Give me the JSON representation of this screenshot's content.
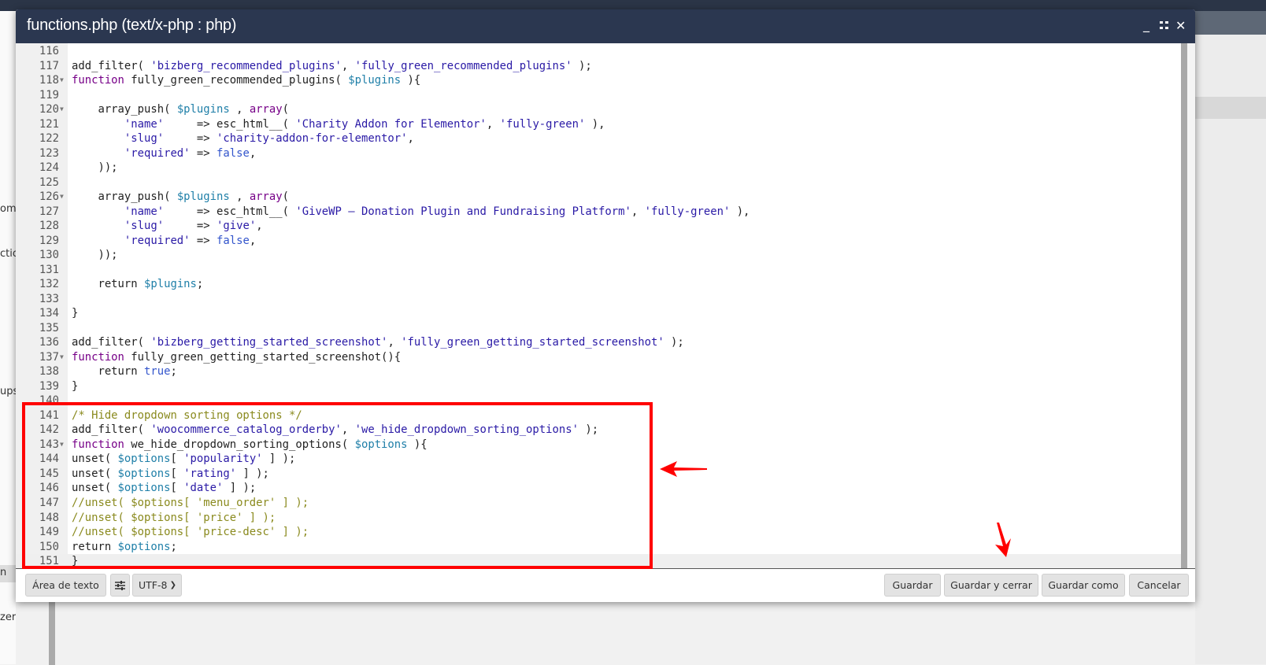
{
  "background_fragments": [
    "om",
    "ctio",
    "ups",
    "n",
    "zer"
  ],
  "dialog": {
    "title": "functions.php (text/x-php : php)",
    "controls": {
      "minimize": "_",
      "maximize": "⛶",
      "close": "✕"
    },
    "footer": {
      "textarea_button": "Área de texto",
      "settings_icon": "sliders-icon",
      "encoding": "UTF-8",
      "save": "Guardar",
      "save_close": "Guardar y cerrar",
      "save_as": "Guardar como",
      "cancel": "Cancelar"
    }
  },
  "annotation_color": "#ff0000",
  "code": [
    {
      "n": "116",
      "t": []
    },
    {
      "n": "117",
      "t": [
        [
          "",
          "add_filter( "
        ],
        [
          "s",
          "'bizberg_recommended_plugins'"
        ],
        [
          "",
          ", "
        ],
        [
          "s",
          "'fully_green_recommended_plugins'"
        ],
        [
          "",
          " );"
        ]
      ]
    },
    {
      "n": "118",
      "fold": true,
      "t": [
        [
          "k",
          "function"
        ],
        [
          "",
          " fully_green_recommended_plugins( "
        ],
        [
          "v",
          "$plugins"
        ],
        [
          "",
          " ){"
        ]
      ]
    },
    {
      "n": "119",
      "t": []
    },
    {
      "n": "120",
      "fold": true,
      "t": [
        [
          "",
          "    array_push( "
        ],
        [
          "v",
          "$plugins"
        ],
        [
          "",
          " , "
        ],
        [
          "k",
          "array"
        ],
        [
          "",
          "("
        ]
      ]
    },
    {
      "n": "121",
      "t": [
        [
          "",
          "        "
        ],
        [
          "s",
          "'name'"
        ],
        [
          "",
          "     => esc_html__( "
        ],
        [
          "s",
          "'Charity Addon for Elementor'"
        ],
        [
          "",
          ", "
        ],
        [
          "s",
          "'fully-green'"
        ],
        [
          "",
          " ),"
        ]
      ]
    },
    {
      "n": "122",
      "t": [
        [
          "",
          "        "
        ],
        [
          "s",
          "'slug'"
        ],
        [
          "",
          "     => "
        ],
        [
          "s",
          "'charity-addon-for-elementor'"
        ],
        [
          "",
          ","
        ]
      ]
    },
    {
      "n": "123",
      "t": [
        [
          "",
          "        "
        ],
        [
          "s",
          "'required'"
        ],
        [
          "",
          " => "
        ],
        [
          "a",
          "false"
        ],
        [
          "",
          ","
        ]
      ]
    },
    {
      "n": "124",
      "t": [
        [
          "",
          "    ));"
        ]
      ]
    },
    {
      "n": "125",
      "t": []
    },
    {
      "n": "126",
      "fold": true,
      "t": [
        [
          "",
          "    array_push( "
        ],
        [
          "v",
          "$plugins"
        ],
        [
          "",
          " , "
        ],
        [
          "k",
          "array"
        ],
        [
          "",
          "("
        ]
      ]
    },
    {
      "n": "127",
      "t": [
        [
          "",
          "        "
        ],
        [
          "s",
          "'name'"
        ],
        [
          "",
          "     => esc_html__( "
        ],
        [
          "s",
          "'GiveWP – Donation Plugin and Fundraising Platform'"
        ],
        [
          "",
          ", "
        ],
        [
          "s",
          "'fully-green'"
        ],
        [
          "",
          " ),"
        ]
      ]
    },
    {
      "n": "128",
      "t": [
        [
          "",
          "        "
        ],
        [
          "s",
          "'slug'"
        ],
        [
          "",
          "     => "
        ],
        [
          "s",
          "'give'"
        ],
        [
          "",
          ","
        ]
      ]
    },
    {
      "n": "129",
      "t": [
        [
          "",
          "        "
        ],
        [
          "s",
          "'required'"
        ],
        [
          "",
          " => "
        ],
        [
          "a",
          "false"
        ],
        [
          "",
          ","
        ]
      ]
    },
    {
      "n": "130",
      "t": [
        [
          "",
          "    ));"
        ]
      ]
    },
    {
      "n": "131",
      "t": []
    },
    {
      "n": "132",
      "t": [
        [
          "",
          "    return "
        ],
        [
          "v",
          "$plugins"
        ],
        [
          "",
          ";"
        ]
      ]
    },
    {
      "n": "133",
      "t": []
    },
    {
      "n": "134",
      "t": [
        [
          "",
          "}"
        ]
      ]
    },
    {
      "n": "135",
      "t": []
    },
    {
      "n": "136",
      "t": [
        [
          "",
          "add_filter( "
        ],
        [
          "s",
          "'bizberg_getting_started_screenshot'"
        ],
        [
          "",
          ", "
        ],
        [
          "s",
          "'fully_green_getting_started_screenshot'"
        ],
        [
          "",
          " );"
        ]
      ]
    },
    {
      "n": "137",
      "fold": true,
      "t": [
        [
          "k",
          "function"
        ],
        [
          "",
          " fully_green_getting_started_screenshot(){"
        ]
      ]
    },
    {
      "n": "138",
      "t": [
        [
          "",
          "    return "
        ],
        [
          "a",
          "true"
        ],
        [
          "",
          ";"
        ]
      ]
    },
    {
      "n": "139",
      "t": [
        [
          "",
          "}"
        ]
      ]
    },
    {
      "n": "140",
      "t": []
    },
    {
      "n": "141",
      "t": [
        [
          "c",
          "/* Hide dropdown sorting options */"
        ]
      ]
    },
    {
      "n": "142",
      "t": [
        [
          "",
          "add_filter( "
        ],
        [
          "s",
          "'woocommerce_catalog_orderby'"
        ],
        [
          "",
          ", "
        ],
        [
          "s",
          "'we_hide_dropdown_sorting_options'"
        ],
        [
          "",
          " );"
        ]
      ]
    },
    {
      "n": "143",
      "fold": true,
      "t": [
        [
          "k",
          "function"
        ],
        [
          "",
          " we_hide_dropdown_sorting_options( "
        ],
        [
          "v",
          "$options"
        ],
        [
          "",
          " ){"
        ]
      ]
    },
    {
      "n": "144",
      "t": [
        [
          "",
          "unset( "
        ],
        [
          "v",
          "$options"
        ],
        [
          "",
          "[ "
        ],
        [
          "s",
          "'popularity'"
        ],
        [
          "",
          " ] );"
        ]
      ]
    },
    {
      "n": "145",
      "t": [
        [
          "",
          "unset( "
        ],
        [
          "v",
          "$options"
        ],
        [
          "",
          "[ "
        ],
        [
          "s",
          "'rating'"
        ],
        [
          "",
          " ] );"
        ]
      ]
    },
    {
      "n": "146",
      "t": [
        [
          "",
          "unset( "
        ],
        [
          "v",
          "$options"
        ],
        [
          "",
          "[ "
        ],
        [
          "s",
          "'date'"
        ],
        [
          "",
          " ] );"
        ]
      ]
    },
    {
      "n": "147",
      "t": [
        [
          "c",
          "//unset( $options[ 'menu_order' ] );"
        ]
      ]
    },
    {
      "n": "148",
      "t": [
        [
          "c",
          "//unset( $options[ 'price' ] );"
        ]
      ]
    },
    {
      "n": "149",
      "t": [
        [
          "c",
          "//unset( $options[ 'price-desc' ] );"
        ]
      ]
    },
    {
      "n": "150",
      "t": [
        [
          "",
          "return "
        ],
        [
          "v",
          "$options"
        ],
        [
          "",
          ";"
        ]
      ]
    },
    {
      "n": "151",
      "active": true,
      "t": [
        [
          "",
          "}"
        ]
      ]
    }
  ]
}
